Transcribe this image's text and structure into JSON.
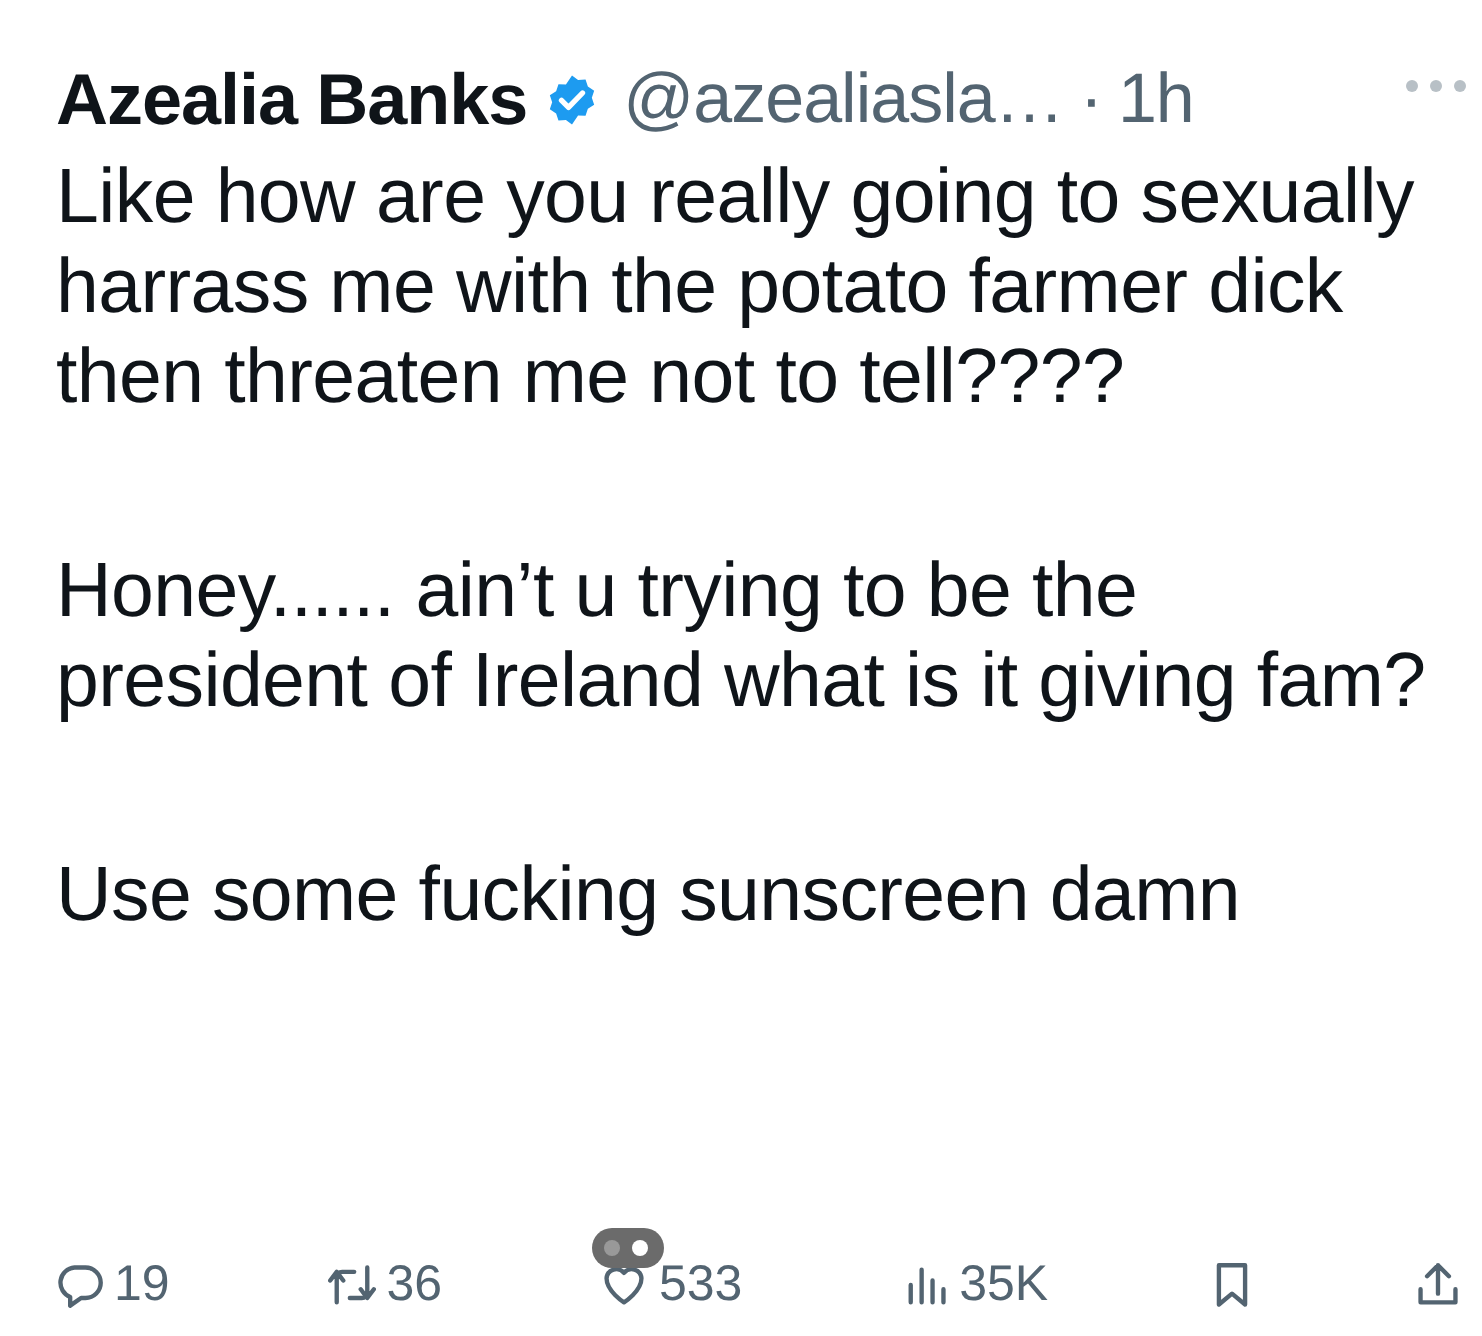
{
  "author": {
    "name": "Azealia Banks",
    "verified": true,
    "handle": "@azealiasla…",
    "separator": "·",
    "time": "1h"
  },
  "paragraphs": [
    "Like how are you really going to sexually harrass me with the potato farmer dick then threaten me not to tell????",
    "Honey...... ain’t u trying to be the president of Ireland what is it giving fam?",
    "Use some fucking sunscreen damn"
  ],
  "actions": [
    {
      "kind": "reply",
      "count": "19"
    },
    {
      "kind": "repost",
      "count": "36"
    },
    {
      "kind": "like",
      "count": "533"
    },
    {
      "kind": "views",
      "count": "35K"
    },
    {
      "kind": "bookmark"
    },
    {
      "kind": "share"
    }
  ]
}
